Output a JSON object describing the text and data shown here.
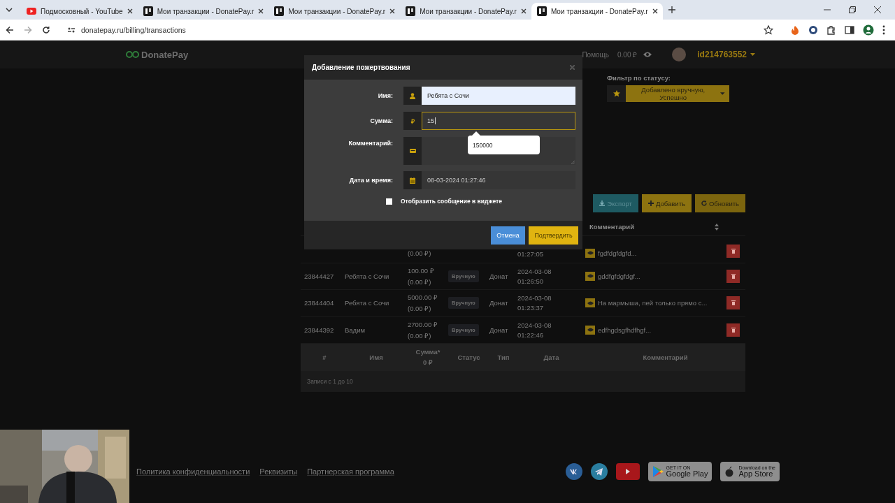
{
  "browser": {
    "tabs": [
      {
        "title": "Подмосковный - YouTube",
        "kind": "youtube",
        "selected": false
      },
      {
        "title": "Мои транзакции - DonatePay.r",
        "kind": "donatepay",
        "selected": false
      },
      {
        "title": "Мои транзакции - DonatePay.r",
        "kind": "donatepay",
        "selected": false
      },
      {
        "title": "Мои транзакции - DonatePay.r",
        "kind": "donatepay",
        "selected": false
      },
      {
        "title": "Мои транзакции - DonatePay.r",
        "kind": "donatepay",
        "selected": true
      }
    ],
    "url": "donatepay.ru/billing/transactions"
  },
  "site": {
    "logo": "DonatePay",
    "help": "Помощь",
    "balance": "0.00 ₽",
    "user": "id214763552"
  },
  "filter": {
    "label": "Фильтр по статусу:",
    "value": "Добавлено вручную, Успешно"
  },
  "actions": [
    {
      "label": "Экспорт",
      "kind": "export"
    },
    {
      "label": "Добавить",
      "kind": "add"
    },
    {
      "label": "Обновить",
      "kind": "refresh"
    }
  ],
  "table": {
    "visible_header": "Комментарий",
    "rows": [
      {
        "amount_note": "(0.00 ₽)",
        "time": "01:27:05",
        "comment": "fgdfdgfdgfd..."
      },
      {
        "id": "23844427",
        "name": "Ребята с Сочи",
        "amount": "100.00 ₽",
        "amount_note": "(0.00 ₽)",
        "status": "Вручную",
        "type": "Донат",
        "date": "2024-03-08",
        "time": "01:26:50",
        "comment": "gddfgfdgfdgf..."
      },
      {
        "id": "23844404",
        "name": "Ребята с Сочи",
        "amount": "5000.00 ₽",
        "amount_note": "(0.00 ₽)",
        "status": "Вручную",
        "type": "Донат",
        "date": "2024-03-08",
        "time": "01:23:37",
        "comment": "На мармыша, пей только прямо с..."
      },
      {
        "id": "23844392",
        "name": "Вадим",
        "amount": "2700.00 ₽",
        "amount_note": "(0.00 ₽)",
        "status": "Вручную",
        "type": "Донат",
        "date": "2024-03-08",
        "time": "01:22:46",
        "comment": "edfhgdsgfhdfhgf..."
      }
    ],
    "footer_columns": [
      {
        "label": "#"
      },
      {
        "label": "Имя"
      },
      {
        "label": "Сумма*",
        "total": "0 ₽"
      },
      {
        "label": "Статус"
      },
      {
        "label": "Тип"
      },
      {
        "label": "Дата"
      },
      {
        "label": "Комментарий"
      }
    ],
    "info": "Записи с 1 до 10"
  },
  "footer": {
    "links": [
      "Политика конфиденциальности",
      "Реквизиты",
      "Партнерская программа"
    ],
    "social": [
      {
        "kind": "vk"
      },
      {
        "kind": "telegram"
      },
      {
        "kind": "youtube"
      }
    ],
    "stores": [
      {
        "kind": "google",
        "small": "GET IT ON",
        "name": "Google Play"
      },
      {
        "kind": "apple",
        "small": "Download on the",
        "name": "App Store"
      }
    ]
  },
  "modal": {
    "title": "Добавление пожертвования",
    "fields": [
      {
        "label": "Имя:",
        "kind": "name",
        "value": "Ребята с Сочи",
        "focused": false,
        "autofilled": true
      },
      {
        "label": "Сумма:",
        "kind": "amount",
        "addon": "₽",
        "value": "15",
        "focused": true,
        "autofilled": false
      },
      {
        "label": "Комментарий:",
        "kind": "comment",
        "focused": false,
        "autofilled": false
      },
      {
        "label": "Дата и время:",
        "kind": "date",
        "value": "08-03-2024 01:27:46",
        "focused": false,
        "autofilled": false
      }
    ],
    "checkbox": {
      "label": "Отобразить сообщение в виджете",
      "checked": false
    },
    "buttons": [
      {
        "label": "Отмена",
        "kind": "cancel"
      },
      {
        "label": "Подтвердить",
        "kind": "confirm"
      }
    ],
    "suggestion": "150000"
  }
}
